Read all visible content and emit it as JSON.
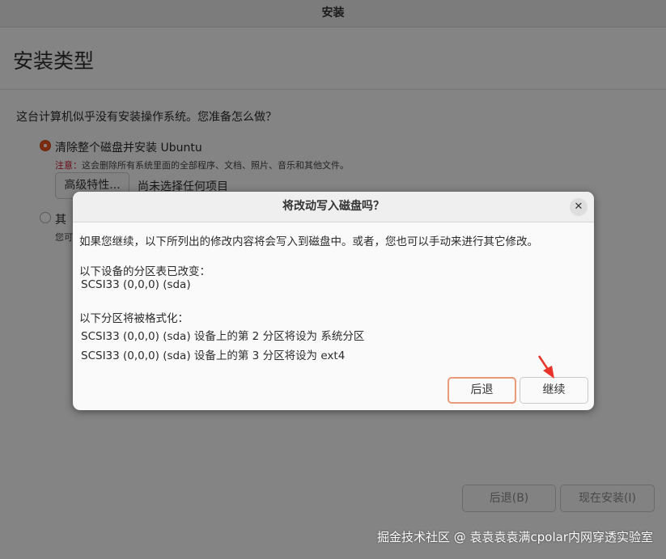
{
  "window": {
    "title": "安装"
  },
  "page": {
    "title": "安装类型"
  },
  "question": "这台计算机似乎没有安装操作系统。您准备怎么做？",
  "options": [
    {
      "label": "清除整个磁盘并安装 Ubuntu",
      "selected": true
    },
    {
      "label": "其他选项",
      "visible_label": "其",
      "selected": false
    }
  ],
  "erase_note": {
    "prefix": "注意：",
    "text": "这会删除所有系统里面的全部程序、文档、照片、音乐和其他文件。"
  },
  "other_note_visible": "您可",
  "advanced": {
    "button_label": "高级特性...",
    "status": "尚未选择任何项目"
  },
  "footer": {
    "back_label": "后退(B)",
    "install_label": "现在安装(I)"
  },
  "dialog": {
    "title": "将改动写入磁盘吗？",
    "close_icon": "close-icon",
    "intro": "如果您继续，以下所列出的修改内容将会写入到磁盘中。或者，您也可以手动来进行其它修改。",
    "partition_table_heading": "以下设备的分区表已改变：",
    "partition_table_device": "SCSI33 (0,0,0) (sda)",
    "format_heading": "以下分区将被格式化：",
    "format_items": [
      "SCSI33 (0,0,0) (sda) 设备上的第 2 分区将设为 系统分区",
      "SCSI33 (0,0,0) (sda) 设备上的第 3 分区将设为 ext4"
    ],
    "back_label": "后退",
    "continue_label": "继续"
  },
  "watermark": "掘金技术社区 @ 袁袁袁袁满cpolar内网穿透实验室",
  "colors": {
    "accent": "#e95420",
    "annotation_arrow": "#e8332a",
    "warning_text": "#c7162b"
  }
}
